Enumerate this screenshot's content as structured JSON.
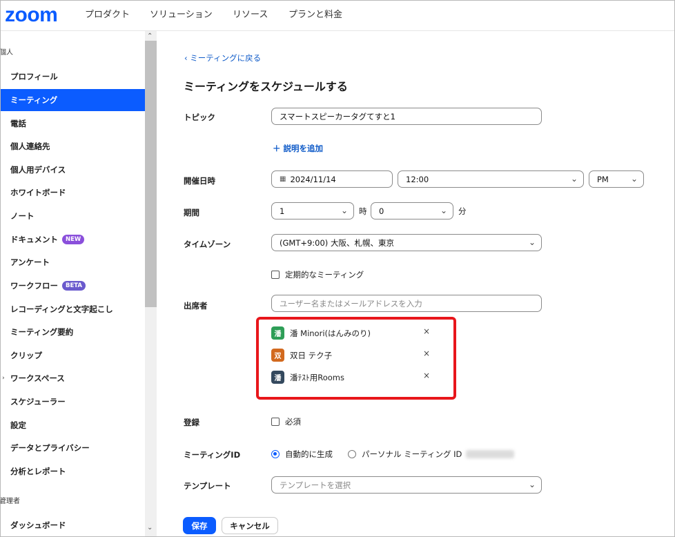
{
  "nav": {
    "logo": "zoom",
    "items": [
      "プロダクト",
      "ソリューション",
      "リソース",
      "プランと料金"
    ]
  },
  "sidebar": {
    "section_personal": "個人",
    "section_admin": "管理者",
    "items": [
      {
        "label": "プロフィール"
      },
      {
        "label": "ミーティング",
        "active": true
      },
      {
        "label": "電話"
      },
      {
        "label": "個人連絡先"
      },
      {
        "label": "個人用デバイス"
      },
      {
        "label": "ホワイトボード"
      },
      {
        "label": "ノート"
      },
      {
        "label": "ドキュメント",
        "badge": "NEW"
      },
      {
        "label": "アンケート"
      },
      {
        "label": "ワークフロー",
        "badge": "BETA"
      },
      {
        "label": "レコーディングと文字起こし"
      },
      {
        "label": "ミーティング要約"
      },
      {
        "label": "クリップ"
      },
      {
        "label": "ワークスペース"
      },
      {
        "label": "スケジューラー"
      },
      {
        "label": "設定"
      },
      {
        "label": "データとプライバシー"
      },
      {
        "label": "分析とレポート"
      }
    ],
    "admin_items": [
      {
        "label": "ダッシュボード"
      }
    ]
  },
  "main": {
    "back_link": "ミーティングに戻る",
    "title": "ミーティングをスケジュールする",
    "topic": {
      "label": "トピック",
      "value": "スマートスピーカータグてすと1"
    },
    "add_description": "説明を追加",
    "datetime": {
      "label": "開催日時",
      "date": "2024/11/14",
      "time": "12:00",
      "ampm": "PM"
    },
    "duration": {
      "label": "期間",
      "hours": "1",
      "hours_unit": "時",
      "minutes": "0",
      "minutes_unit": "分"
    },
    "timezone": {
      "label": "タイムゾーン",
      "value": "(GMT+9:00) 大阪、札幌、東京"
    },
    "recurring": {
      "label": "定期的なミーティング"
    },
    "attendees": {
      "label": "出席者",
      "placeholder": "ユーザー名またはメールアドレスを入力",
      "list": [
        {
          "initial": "潘",
          "name": "潘 Minori(はんみのり)",
          "color": "#2e9e57"
        },
        {
          "initial": "双",
          "name": "双日 テク子",
          "color": "#d2691e"
        },
        {
          "initial": "潘",
          "name": "潘ﾃｽﾄ用Rooms",
          "color": "#34495e"
        }
      ]
    },
    "registration": {
      "label": "登録",
      "option": "必須"
    },
    "meeting_id": {
      "label": "ミーティングID",
      "auto": "自動的に生成",
      "personal": "パーソナル ミーティング ID"
    },
    "template": {
      "label": "テンプレート",
      "placeholder": "テンプレートを選択"
    },
    "buttons": {
      "save": "保存",
      "cancel": "キャンセル"
    }
  },
  "colors": {
    "accent": "#0b5cff",
    "highlight": "#e8161b"
  }
}
